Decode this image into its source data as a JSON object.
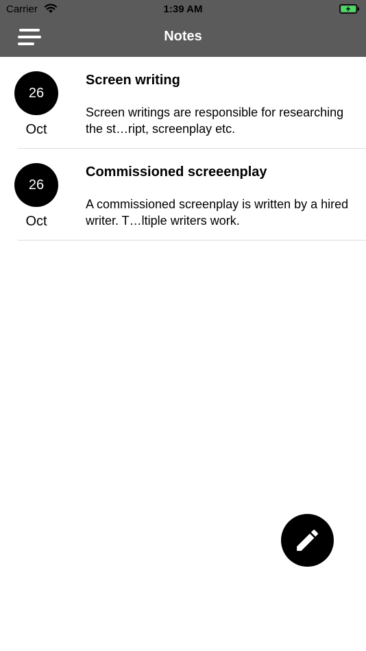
{
  "status_bar": {
    "carrier": "Carrier",
    "time": "1:39 AM",
    "icons": [
      "wifi-icon",
      "battery-charging-icon"
    ],
    "battery_color": "#4cd964"
  },
  "nav_bar": {
    "title": "Notes",
    "menu_icon": "hamburger-menu-icon",
    "background": "#5b5b5b"
  },
  "notes": [
    {
      "day": "26",
      "month": "Oct",
      "title": "Screen writing",
      "preview": "Screen writings are responsible for researching the st…ript, screenplay etc."
    },
    {
      "day": "26",
      "month": "Oct",
      "title": "Commissioned screeenplay",
      "preview": "A commissioned screenplay is written by a hired writer. T…ltiple writers work."
    }
  ],
  "fab": {
    "icon": "pencil-icon"
  }
}
